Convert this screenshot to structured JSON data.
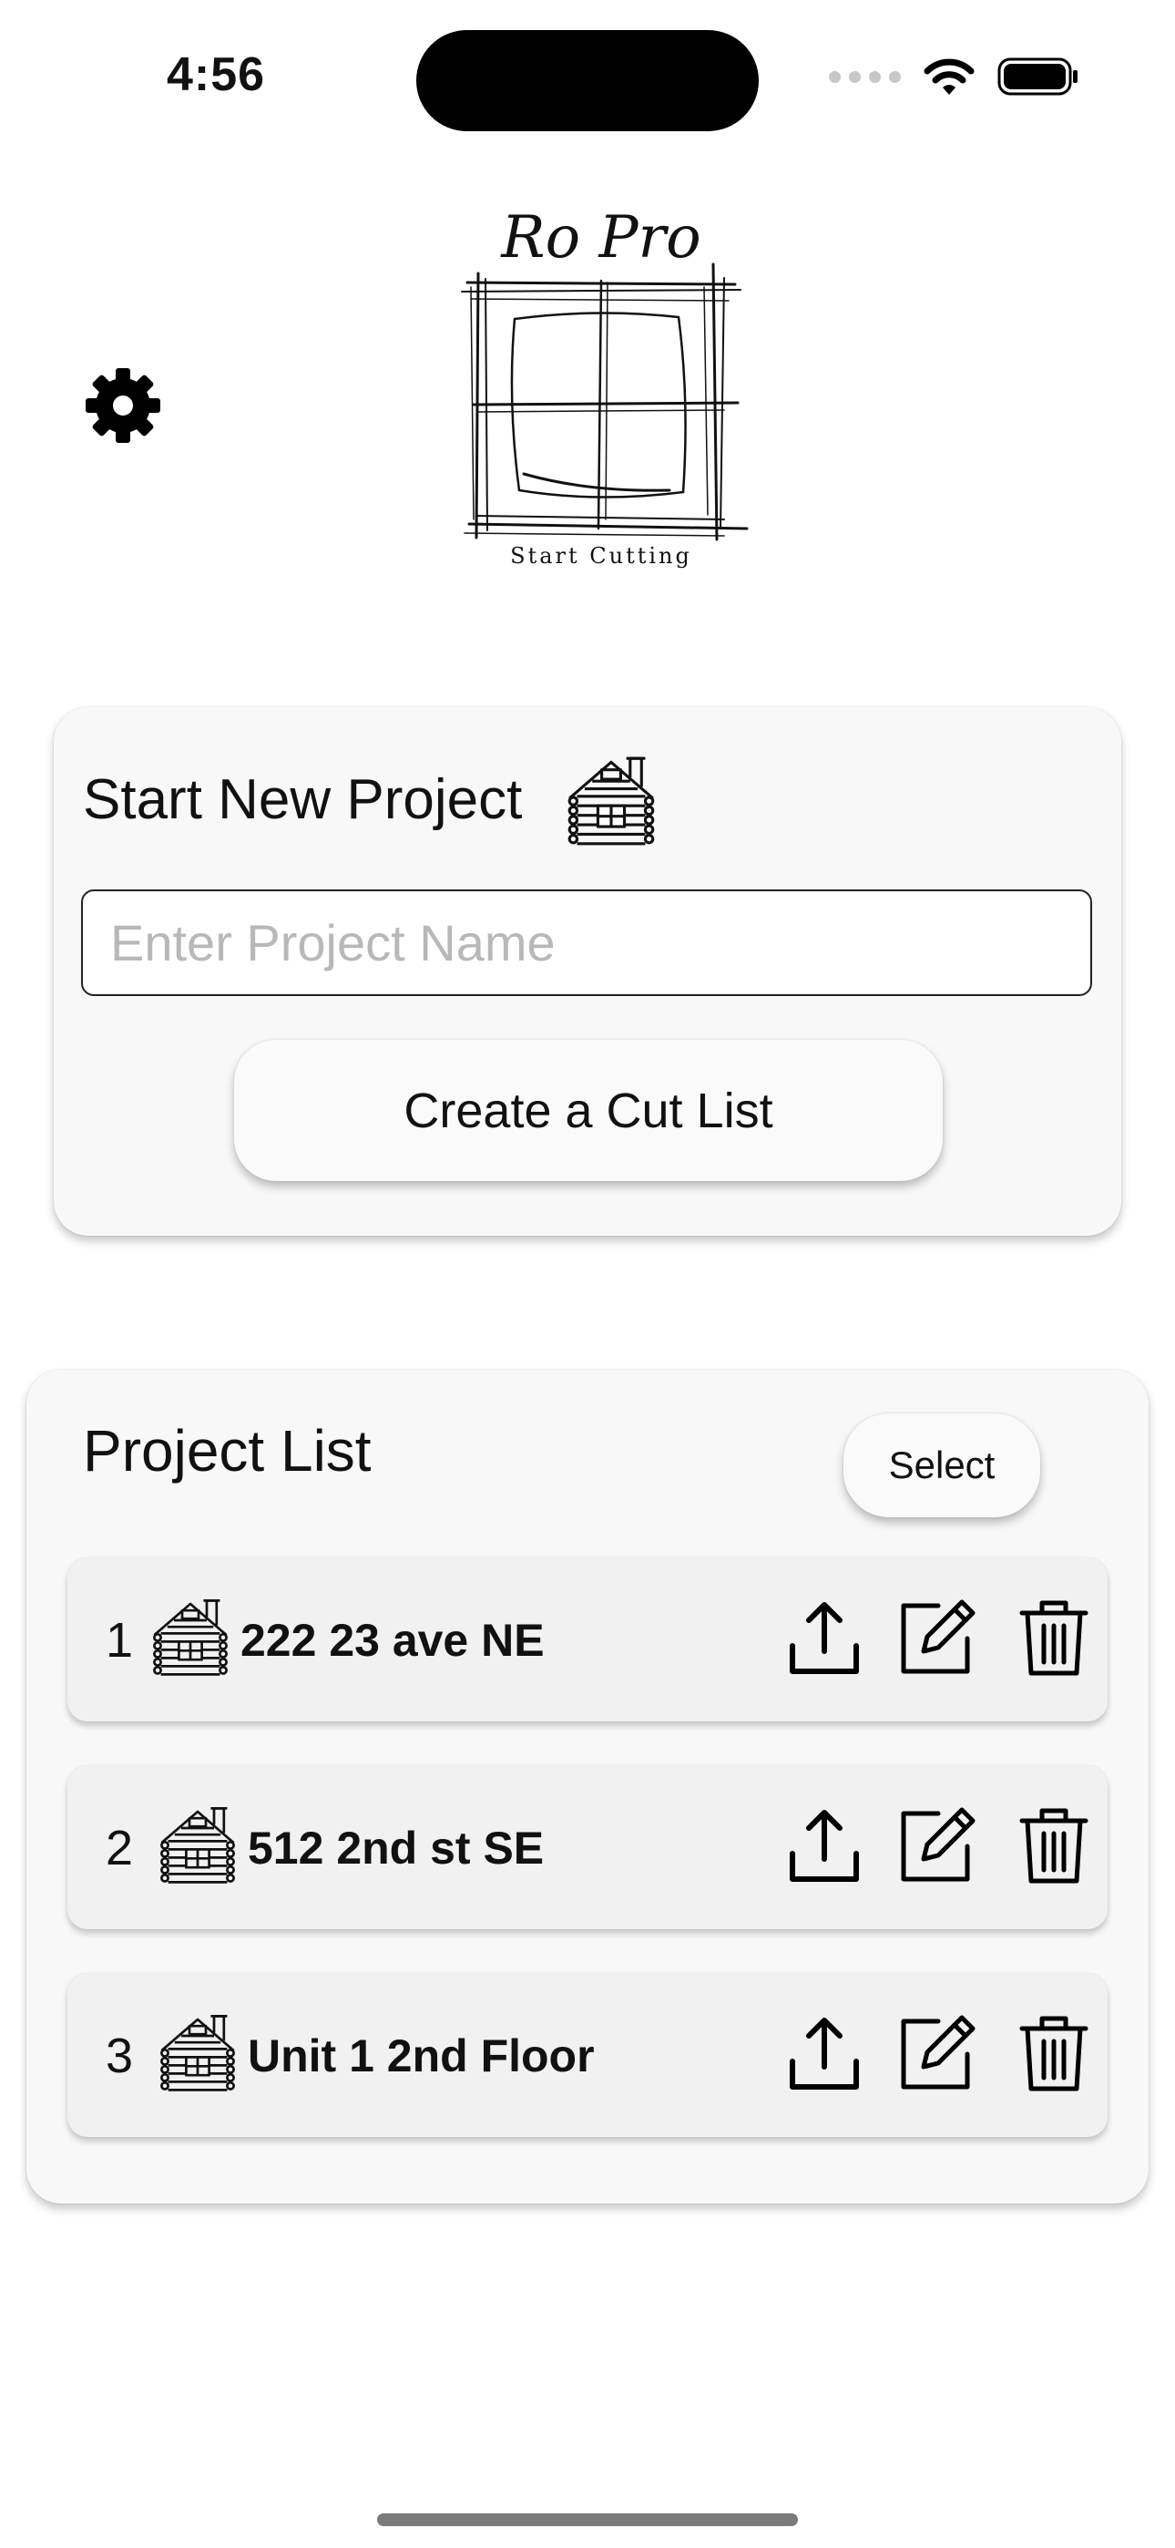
{
  "status_bar": {
    "time": "4:56"
  },
  "logo": {
    "title": "Ro Pro",
    "tagline": "Start Cutting"
  },
  "new_project": {
    "title": "Start New Project",
    "input_placeholder": "Enter Project Name",
    "input_value": "",
    "create_label": "Create a Cut List"
  },
  "project_list": {
    "title": "Project List",
    "select_label": "Select",
    "items": [
      {
        "index": "1",
        "name": "222 23 ave NE"
      },
      {
        "index": "2",
        "name": "512 2nd st SE"
      },
      {
        "index": "3",
        "name": "Unit 1 2nd Floor"
      }
    ]
  },
  "icons": [
    "gear-icon",
    "cabin-icon",
    "share-icon",
    "edit-icon",
    "trash-icon",
    "wifi-icon",
    "battery-icon"
  ]
}
